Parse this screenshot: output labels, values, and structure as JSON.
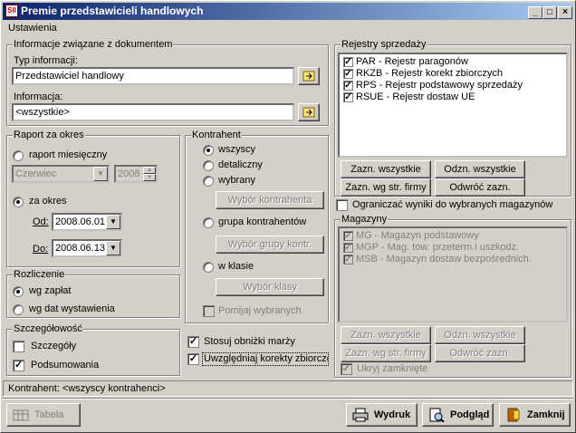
{
  "window": {
    "title": "Premie przedstawicieli handlowych",
    "icon_text": "SII",
    "min": "_",
    "max": "□",
    "close": "×"
  },
  "menu": {
    "settings": "Ustawienia"
  },
  "doc_info": {
    "group": "Informacje związane z dokumentem",
    "type_label": "Typ informacji:",
    "type_value": "Przedstawiciel handlowy",
    "info_label": "Informacja:",
    "info_value": "<wszystkie>"
  },
  "report": {
    "group": "Raport za okres",
    "monthly": "raport miesięczny",
    "month": "Czerwiec",
    "year": "2008",
    "period": "za okres",
    "from_label": "Od:",
    "from": "2008.06.01",
    "to_label": "Do:",
    "to": "2008.06.13"
  },
  "settlement": {
    "group": "Rozliczenie",
    "by_payment": "wg zapłat",
    "by_issue": "wg dat wystawienia"
  },
  "detail": {
    "group": "Szczegółowość",
    "details": "Szczegóły",
    "summary": "Podsumowania"
  },
  "contractor": {
    "group": "Kontrahent",
    "all": "wszyscy",
    "retail": "detaliczny",
    "selected": "wybrany",
    "choose_contractor": "Wybór kontrahenta",
    "group_opt": "grupa kontrahentów",
    "choose_group": "Wybór grupy kontr.",
    "in_class": "w klasie",
    "choose_class": "Wybór klasy",
    "skip_selected": "Pomijaj wybranych"
  },
  "options": {
    "markup_discount": "Stosuj obniżki marży",
    "corrections": "Uwzględniaj korekty zbiorcze"
  },
  "registers": {
    "group": "Rejestry sprzedaży",
    "items": [
      "PAR - Rejestr paragonów",
      "RKZB - Rejestr korekt zbiorczych",
      "RPS - Rejestr podstawowy sprzedaży",
      "RSUE - Rejestr dostaw UE"
    ],
    "select_all": "Zazn. wszystkie",
    "deselect_all": "Odzn. wszystkie",
    "select_by_company": "Zazn. wg str. firmy",
    "invert": "Odwróć zazn."
  },
  "limit_wh": "Ograniczać wyniki do wybranych magazynów",
  "warehouses": {
    "group": "Magazyny",
    "items": [
      "MG - Magazyn podstawowy",
      "MGP - Mag. tow. przeterm.i uszkodz.",
      "MSB - Magazyn dostaw bezpośrednich."
    ],
    "select_all": "Zazn. wszystkie",
    "deselect_all": "Odzn. wszystkie",
    "select_by_company": "Zazn. wg str. firmy",
    "invert": "Odwróć zazn.",
    "hide_closed": "Ukryj zamknięte"
  },
  "status": "Kontrahent:  <wszyscy kontrahenci>",
  "buttons": {
    "table": "Tabela",
    "print": "Wydruk",
    "preview": "Podgląd",
    "close": "Zamknij"
  }
}
